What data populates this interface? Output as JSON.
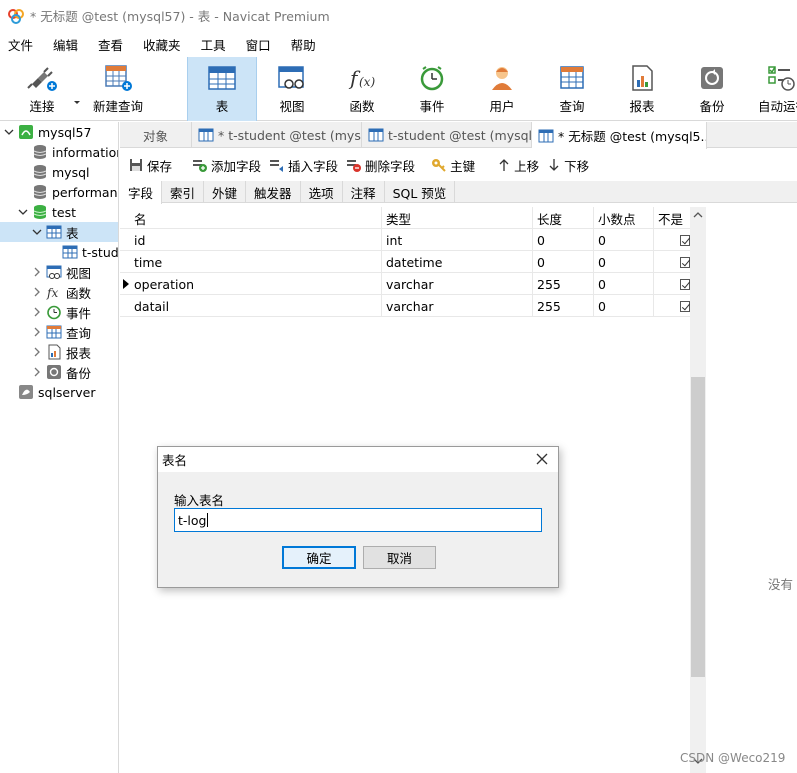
{
  "window": {
    "title": "* 无标题 @test (mysql57) - 表 - Navicat Premium"
  },
  "menu": [
    "文件",
    "编辑",
    "查看",
    "收藏夹",
    "工具",
    "窗口",
    "帮助"
  ],
  "toolbar": {
    "connect": "连接",
    "new_query": "新建查询",
    "table": "表",
    "view": "视图",
    "function": "函数",
    "event": "事件",
    "user": "用户",
    "query": "查询",
    "report": "报表",
    "backup": "备份",
    "auto_run": "自动运行"
  },
  "sidebar": {
    "items": [
      {
        "label": "mysql57"
      },
      {
        "label": "information"
      },
      {
        "label": "mysql"
      },
      {
        "label": "performan"
      },
      {
        "label": "test"
      },
      {
        "label": "表"
      },
      {
        "label": "t-stud"
      },
      {
        "label": "视图"
      },
      {
        "label": "函数"
      },
      {
        "label": "事件"
      },
      {
        "label": "查询"
      },
      {
        "label": "报表"
      },
      {
        "label": "备份"
      },
      {
        "label": "sqlserver"
      }
    ]
  },
  "tabs": {
    "objects": "对象",
    "tab1": "* t-student @test (mys...",
    "tab2": "t-student @test (mysql...",
    "tab3": "* 无标题 @test (mysql5..."
  },
  "edit_toolbar": {
    "save": "保存",
    "add_field": "添加字段",
    "insert_field": "插入字段",
    "delete_field": "删除字段",
    "primary_key": "主键",
    "move_up": "上移",
    "move_down": "下移"
  },
  "subtabs": [
    "字段",
    "索引",
    "外键",
    "触发器",
    "选项",
    "注释",
    "SQL 预览"
  ],
  "grid": {
    "columns": [
      "名",
      "类型",
      "长度",
      "小数点",
      "不是"
    ],
    "rows": [
      {
        "name": "id",
        "type": "int",
        "length": "0",
        "decimals": "0"
      },
      {
        "name": "time",
        "type": "datetime",
        "length": "0",
        "decimals": "0"
      },
      {
        "name": "operation",
        "type": "varchar",
        "length": "255",
        "decimals": "0"
      },
      {
        "name": "datail",
        "type": "varchar",
        "length": "255",
        "decimals": "0"
      }
    ]
  },
  "dialog": {
    "title": "表名",
    "prompt": "输入表名",
    "input_value": "t-log",
    "ok": "确定",
    "cancel": "取消"
  },
  "right_text": "没有",
  "watermark": "CSDN @Weco219"
}
